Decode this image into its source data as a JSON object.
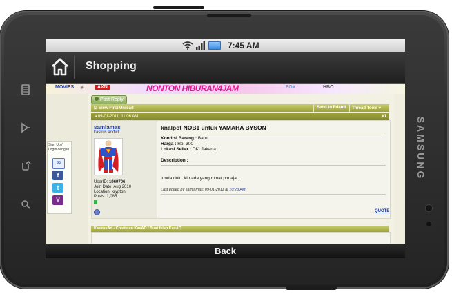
{
  "device": {
    "brand": "SAMSUNG",
    "status_time": "7:45 AM"
  },
  "app": {
    "title": "Shopping",
    "back_label": "Back"
  },
  "banner": {
    "movies_label": "MOVIES",
    "axn_label": "AXN",
    "main_text": "NONTON HIBURAN4JAM",
    "fox_label": "FOX",
    "hbo_label": "HBO"
  },
  "forum": {
    "post_reply_label": "Post Reply",
    "view_first_unread": "View First Unread",
    "send_to_friend": "Send to Friend",
    "thread_tools": "Thread Tools",
    "post_date": "09-01-2011, 11:06 AM",
    "post_number": "#1",
    "signup_text": "Sign Up / Login dengan",
    "user": {
      "name": "samlamas",
      "title": "kaskus addict",
      "userid_label": "UserID:",
      "userid": "1969706",
      "join_date": "Join Date: Aug 2010",
      "location": "Location: krypton",
      "posts": "Posts: 1,085"
    },
    "post": {
      "title": "knalpot NOB1 untuk YAMAHA BYSON",
      "kondisi_label": "Kondisi Barang :",
      "kondisi_value": "Baru",
      "harga_label": "Harga :",
      "harga_value": "Rp. 300",
      "lokasi_label": "Lokasi Seller :",
      "lokasi_value": "DKI Jakarta",
      "deskripsi_label": "Description :",
      "body": "tunda dulu ,klo ada yang minat pm aja..",
      "edited_prefix": "Last edited by samlamas; 09-01-2011 at",
      "edited_time": "10:23 AM",
      "edited_suffix": ".",
      "quote_label": "QUOTE"
    },
    "kaskus_ad": "KaskusAd - Create an KasAD / Buat Iklan KasAD"
  },
  "colors": {
    "forum_header": "#9ea23c",
    "link_blue": "#1e3aa8",
    "title_bar": "#2b2b2b"
  }
}
